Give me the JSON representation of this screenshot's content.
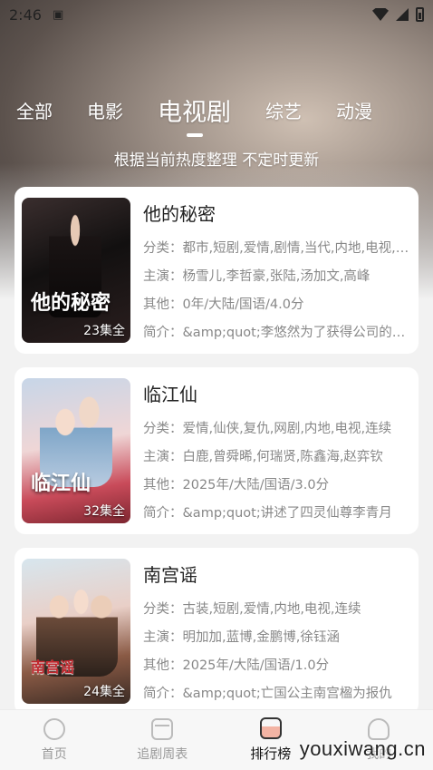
{
  "status_bar": {
    "time": "2:46",
    "icons": [
      "notification-icon",
      "wifi-icon",
      "signal-icon",
      "battery-icon"
    ]
  },
  "tabs": [
    {
      "label": "全部",
      "active": false
    },
    {
      "label": "电影",
      "active": false
    },
    {
      "label": "电视剧",
      "active": true
    },
    {
      "label": "综艺",
      "active": false
    },
    {
      "label": "动漫",
      "active": false
    }
  ],
  "subtitle": "根据当前热度整理 不定时更新",
  "items": [
    {
      "title": "他的秘密",
      "poster_title": "他的秘密",
      "episodes": "23集全",
      "category": "分类：都市,短剧,爱情,剧情,当代,内地,电视,连续",
      "cast": "主演：杨雪儿,李哲豪,张陆,汤加文,高峰",
      "other": "其他：0年/大陆/国语/4.0分",
      "intro": "简介：&amp;quot;李悠然为了获得公司的继承权"
    },
    {
      "title": "临江仙",
      "poster_title": "临江仙",
      "episodes": "32集全",
      "category": "分类：爱情,仙侠,复仇,网剧,内地,电视,连续",
      "cast": "主演：白鹿,曾舜晞,何瑞贤,陈鑫海,赵弈钦",
      "other": "其他：2025年/大陆/国语/3.0分",
      "intro": "简介：&amp;quot;讲述了四灵仙尊李青月"
    },
    {
      "title": "南宫谣",
      "poster_title": "南宫谣",
      "episodes": "24集全",
      "category": "分类：古装,短剧,爱情,内地,电视,连续",
      "cast": "主演：明加加,蓝博,金鹏博,徐钰涵",
      "other": "其他：2025年/大陆/国语/1.0分",
      "intro": "简介：&amp;quot;亡国公主南宫楹为报仇"
    }
  ],
  "bottom_nav": [
    {
      "label": "首页",
      "icon": "home-icon",
      "active": false
    },
    {
      "label": "追剧周表",
      "icon": "calendar-icon",
      "active": false
    },
    {
      "label": "排行榜",
      "icon": "ranking-icon",
      "active": true
    },
    {
      "label": "我的",
      "icon": "user-icon",
      "active": false
    }
  ],
  "watermark": "youxiwang.cn"
}
